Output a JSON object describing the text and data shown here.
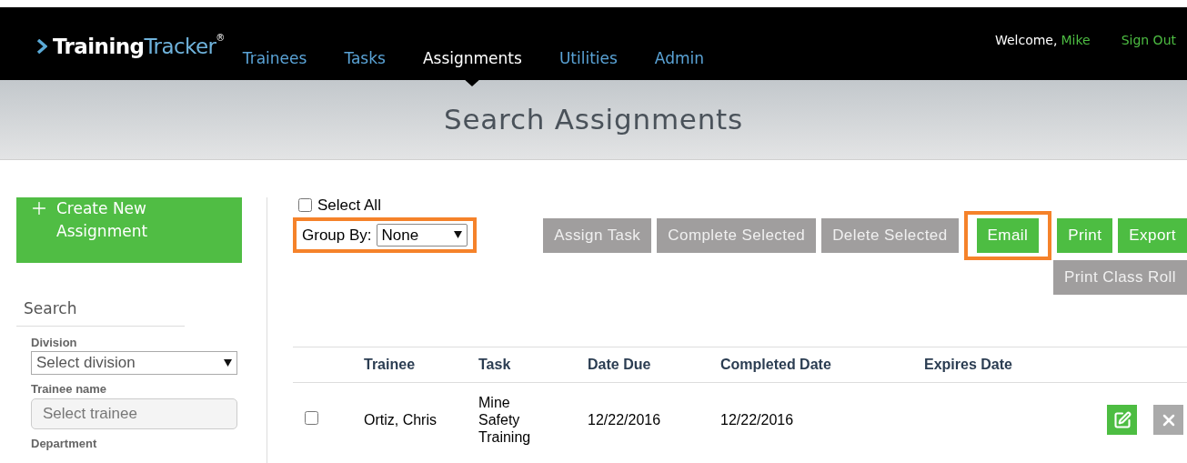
{
  "header": {
    "logo": {
      "part1": "Training",
      "part2": "Tracker",
      "mark": "®"
    },
    "nav": [
      {
        "label": "Trainees",
        "selected": false
      },
      {
        "label": "Tasks",
        "selected": false
      },
      {
        "label": "Assignments",
        "selected": true
      },
      {
        "label": "Utilities",
        "selected": false
      },
      {
        "label": "Admin",
        "selected": false
      }
    ],
    "welcome": "Welcome,",
    "user": "Mike",
    "sign_out": "Sign Out"
  },
  "banner": {
    "title": "Search Assignments"
  },
  "sidebar": {
    "create_button": "Create New Assignment",
    "search_heading": "Search",
    "fields": [
      {
        "kind": "select",
        "label": "Division",
        "placeholder": "Select division"
      },
      {
        "kind": "text",
        "label": "Trainee name",
        "placeholder": "Select trainee"
      },
      {
        "kind": "label",
        "label": "Department"
      }
    ]
  },
  "toolbar": {
    "select_all": {
      "label": "Select All",
      "checked": false
    },
    "group_by": {
      "label": "Group By:",
      "value": "None",
      "highlighted": true
    },
    "buttons": [
      {
        "label": "Assign Task",
        "kind": "gray",
        "highlighted": false
      },
      {
        "label": "Complete Selected",
        "kind": "gray",
        "highlighted": false
      },
      {
        "label": "Delete Selected",
        "kind": "gray",
        "highlighted": false
      },
      {
        "label": "Email",
        "kind": "green",
        "highlighted": true
      },
      {
        "label": "Print",
        "kind": "green",
        "highlighted": false
      },
      {
        "label": "Export",
        "kind": "green",
        "highlighted": false
      }
    ],
    "second_row": [
      {
        "label": "Print Class Roll",
        "kind": "gray",
        "highlighted": false
      }
    ]
  },
  "table": {
    "columns": [
      "Trainee",
      "Task",
      "Date Due",
      "Completed Date",
      "Expires Date"
    ],
    "rows": [
      {
        "checked": false,
        "cells": [
          "Ortiz, Chris",
          "Mine Safety Training",
          "12/22/2016",
          "12/22/2016",
          ""
        ]
      }
    ]
  }
}
